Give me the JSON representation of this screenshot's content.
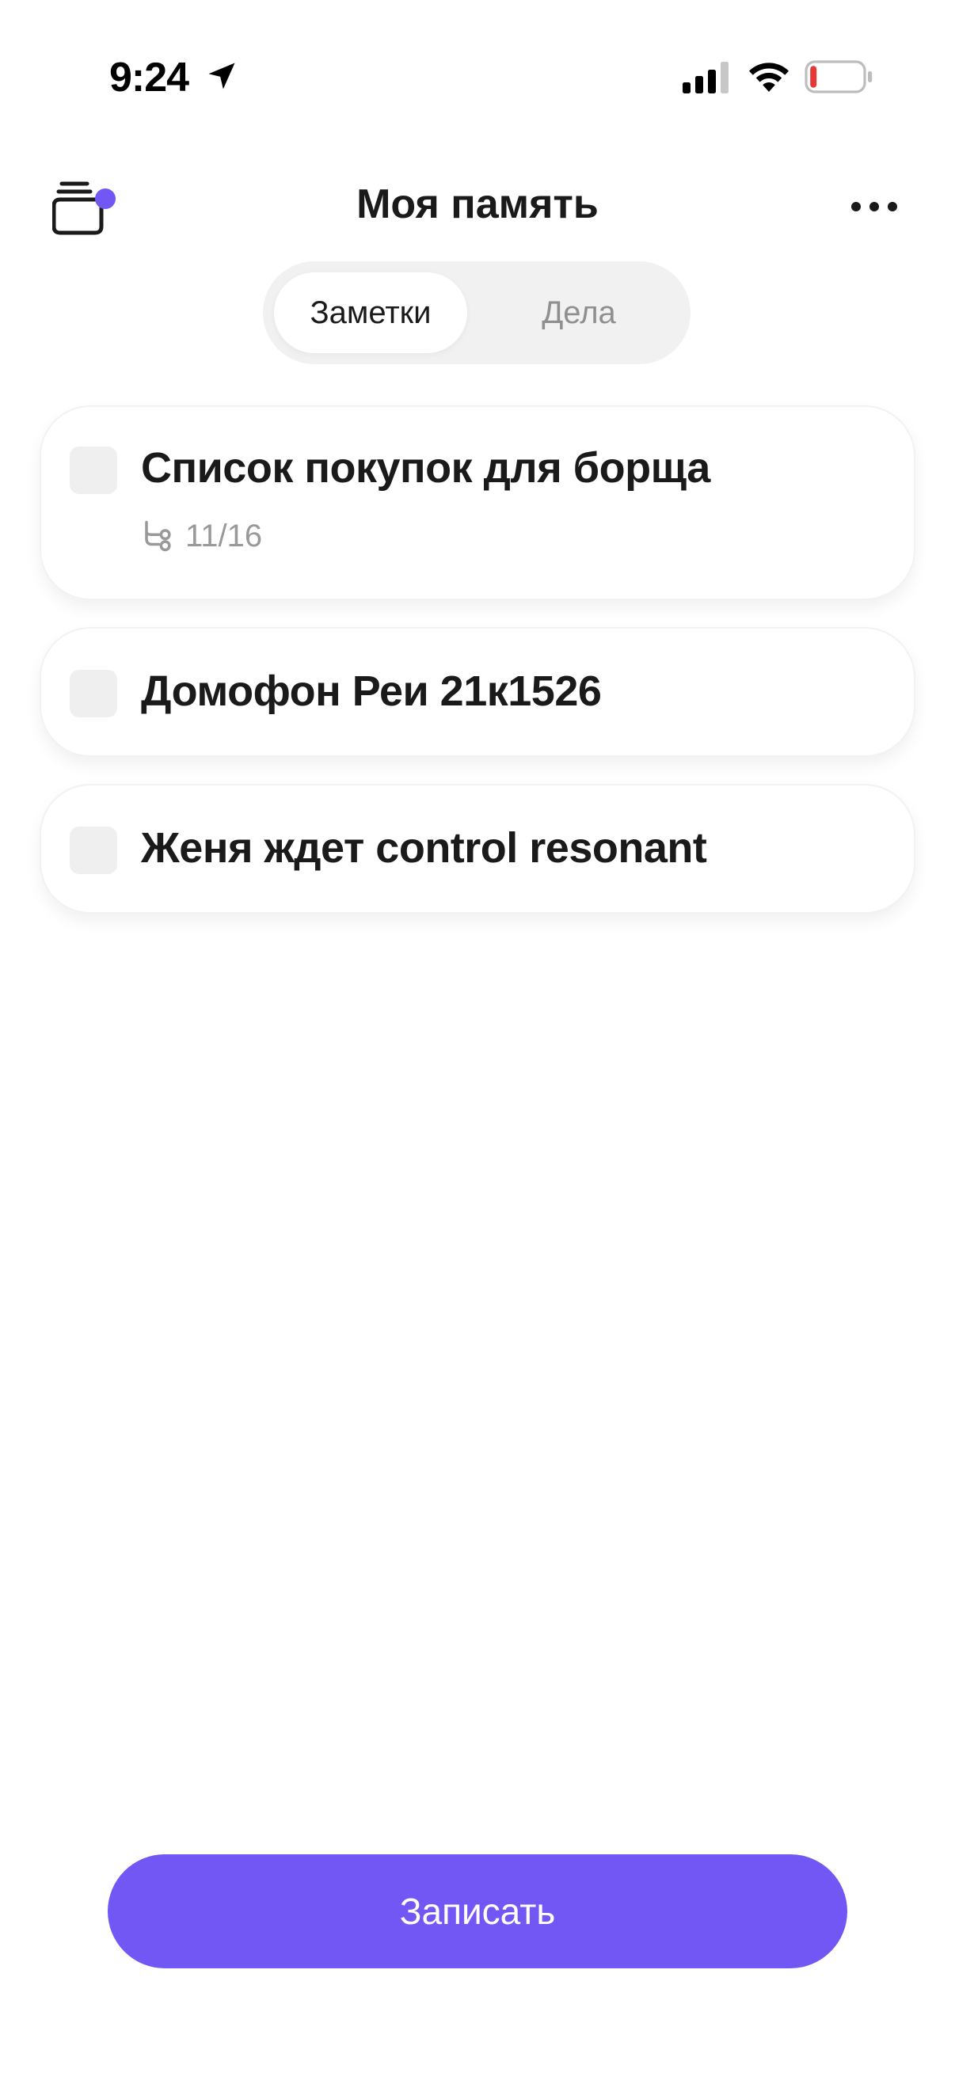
{
  "status_bar": {
    "time": "9:24",
    "icons": [
      "location-arrow-icon",
      "cellular-signal-icon",
      "wifi-icon",
      "battery-low-icon"
    ]
  },
  "header": {
    "title": "Моя память",
    "left_icon": "cards-stack-icon",
    "right_icon": "more-dots-icon"
  },
  "tabs": {
    "active": "Заметки",
    "inactive": "Дела"
  },
  "notes": [
    {
      "title": "Список покупок для борща",
      "subtasks": "11/16"
    },
    {
      "title": "Домофон Реи 21к1526"
    },
    {
      "title": "Женя ждет control resonant"
    }
  ],
  "record_button": {
    "label": "Записать"
  },
  "colors": {
    "accent": "#7257f5",
    "battery_low": "#e53935"
  }
}
